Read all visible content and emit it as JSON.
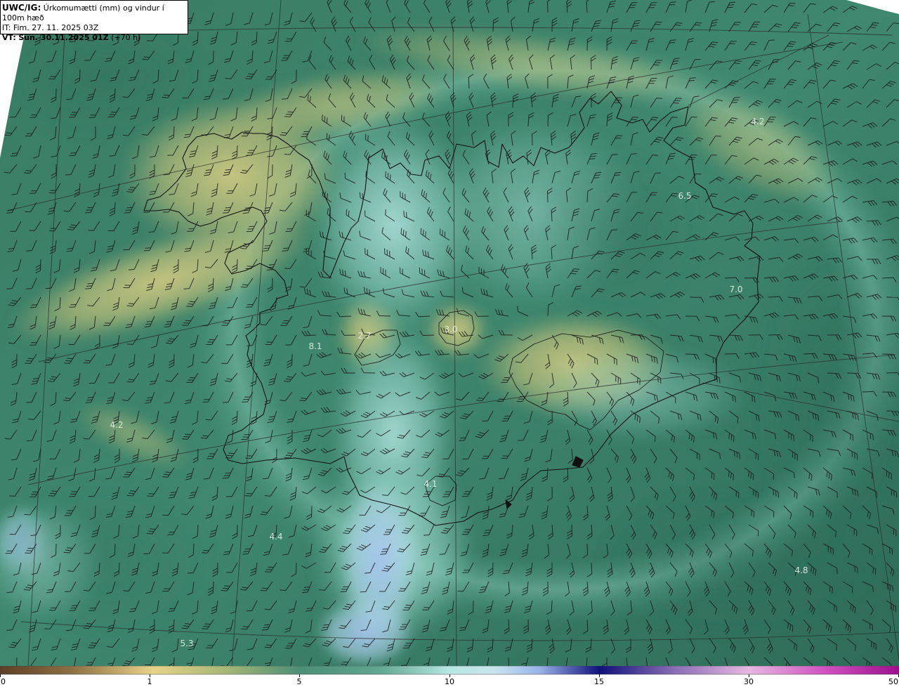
{
  "header": {
    "line1_key": "UWC/IG:",
    "line1_text": "Úrkomumætti (mm) og vindur í 100m hæð",
    "line2_key": "IT:",
    "line2_text": "Fim. 27. 11. 2025 03Z",
    "line3_key": "VT:",
    "line3_text": "Sun. 30.11.2025 01Z",
    "line3_suffix": "(+70 h)"
  },
  "value_labels": [
    "4.2",
    "6.5",
    "7.0",
    "3.0",
    "2.7",
    "8.1",
    "4.2",
    "4.1",
    "4.4",
    "4.8",
    "5.3"
  ],
  "colorbar": {
    "ticks": [
      "0",
      "1",
      "5",
      "10",
      "15",
      "30",
      "50"
    ],
    "tick_values": [
      0,
      1,
      5,
      10,
      15,
      30,
      50
    ]
  },
  "colors": {
    "sea_dark": "#2f6e5a",
    "sea_mid": "#3f8a72",
    "precip_low": "#c2c277",
    "precip_mid": "#5fa58f",
    "precip_high": "#b6e1de",
    "precip_very_high": "#9fbdea",
    "coast": "#111111"
  }
}
